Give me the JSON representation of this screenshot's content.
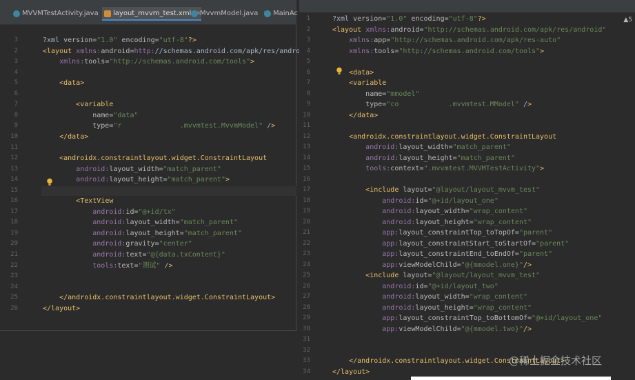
{
  "tabs": [
    {
      "label": "MVVMTestActivity.java",
      "type": "java"
    },
    {
      "label": "layout_mvvm_test.xml",
      "type": "xml"
    },
    {
      "label": "MvvmModel.java",
      "type": "java"
    },
    {
      "label": "MainAc",
      "type": "java"
    }
  ],
  "right_panel": {
    "warning_count": "▲5"
  },
  "left_code": [
    {
      "n": "3",
      "t": "<?xml version=\"1.0\" encoding=\"utf-8\"?>"
    },
    {
      "n": "2",
      "t": "<layout xmlns:android=\"http://schemas.android.com/apk/res/androi"
    },
    {
      "n": "3",
      "t": "    xmlns:tools=\"http://schemas.android.com/tools\">"
    },
    {
      "n": "4",
      "t": ""
    },
    {
      "n": "5",
      "t": "    <data>"
    },
    {
      "n": "6",
      "t": ""
    },
    {
      "n": "7",
      "t": "        <variable"
    },
    {
      "n": "8",
      "t": "            name=\"data\""
    },
    {
      "n": "9",
      "t": "            type=\"r              .mvvmtest.MvvmModel\" />"
    },
    {
      "n": "10",
      "t": "    </data>"
    },
    {
      "n": "11",
      "t": ""
    },
    {
      "n": "12",
      "t": "    <androidx.constraintlayout.widget.ConstraintLayout"
    },
    {
      "n": "13",
      "t": "        android:layout_width=\"match_parent\""
    },
    {
      "n": "14",
      "t": "        android:layout_height=\"match_parent\">"
    },
    {
      "n": "15",
      "t": ""
    },
    {
      "n": "16",
      "t": "        <TextView"
    },
    {
      "n": "17",
      "t": "            android:id=\"@+id/tx\""
    },
    {
      "n": "18",
      "t": "            android:layout_width=\"match_parent\""
    },
    {
      "n": "19",
      "t": "            android:layout_height=\"match_parent\""
    },
    {
      "n": "20",
      "t": "            android:gravity=\"center\""
    },
    {
      "n": "21",
      "t": "            android:text=\"@{data.txContent}\""
    },
    {
      "n": "22",
      "t": "            tools:text=\"测试\" />"
    },
    {
      "n": "23",
      "t": ""
    },
    {
      "n": "24",
      "t": ""
    },
    {
      "n": "25",
      "t": "    </androidx.constraintlayout.widget.ConstraintLayout>"
    },
    {
      "n": "26",
      "t": "</layout>"
    }
  ],
  "right_code": [
    {
      "n": "1",
      "t": "<?xml version=\"1.0\" encoding=\"utf-8\"?>"
    },
    {
      "n": "2",
      "t": "<layout xmlns:android=\"http://schemas.android.com/apk/res/android\""
    },
    {
      "n": "3",
      "t": "    xmlns:app=\"http://schemas.android.com/apk/res-auto\""
    },
    {
      "n": "4",
      "t": "    xmlns:tools=\"http://schemas.android.com/tools\">"
    },
    {
      "n": "5",
      "t": ""
    },
    {
      "n": "6",
      "t": "    <data>"
    },
    {
      "n": "7",
      "t": "    <variable"
    },
    {
      "n": "8",
      "t": "        name=\"mmodel\""
    },
    {
      "n": "9",
      "t": "        type=\"co            .mvvmtest.MModel\" />"
    },
    {
      "n": "10",
      "t": "    </data>"
    },
    {
      "n": "11",
      "t": ""
    },
    {
      "n": "12",
      "t": "    <androidx.constraintlayout.widget.ConstraintLayout"
    },
    {
      "n": "13",
      "t": "        android:layout_width=\"match_parent\""
    },
    {
      "n": "14",
      "t": "        android:layout_height=\"match_parent\""
    },
    {
      "n": "15",
      "t": "        tools:context=\".mvvmtest.MVVMTestActivity\">"
    },
    {
      "n": "16",
      "t": ""
    },
    {
      "n": "17",
      "t": "        <include layout=\"@layout/layout_mvvm_test\""
    },
    {
      "n": "18",
      "t": "            android:id=\"@+id/layout_one\""
    },
    {
      "n": "19",
      "t": "            android:layout_width=\"wrap_content\""
    },
    {
      "n": "20",
      "t": "            android:layout_height=\"wrap_content\""
    },
    {
      "n": "21",
      "t": "            app:layout_constraintTop_toTopOf=\"parent\""
    },
    {
      "n": "22",
      "t": "            app:layout_constraintStart_toStartOf=\"parent\""
    },
    {
      "n": "23",
      "t": "            app:layout_constraintEnd_toEndOf=\"parent\""
    },
    {
      "n": "24",
      "t": "            app:viewModelChild=\"@{mmodel.one}\"/>"
    },
    {
      "n": "25",
      "t": "        <include layout=\"@layout/layout_mvvm_test\""
    },
    {
      "n": "26",
      "t": "            android:id=\"@+id/layout_two\""
    },
    {
      "n": "27",
      "t": "            android:layout_width=\"wrap_content\""
    },
    {
      "n": "28",
      "t": "            android:layout_height=\"wrap_content\""
    },
    {
      "n": "29",
      "t": "            app:layout_constraintTop_toBottomOf=\"@+id/layout_one\""
    },
    {
      "n": "30",
      "t": "            app:viewModelChild=\"@{mmodel.two}\"/>"
    },
    {
      "n": "31",
      "t": ""
    },
    {
      "n": "32",
      "t": ""
    },
    {
      "n": "33",
      "t": "    </androidx.constraintlayout.widget.ConstraintLayout>"
    },
    {
      "n": "34",
      "t": "</layout>"
    }
  ],
  "watermark": "@稀土掘金技术社区"
}
